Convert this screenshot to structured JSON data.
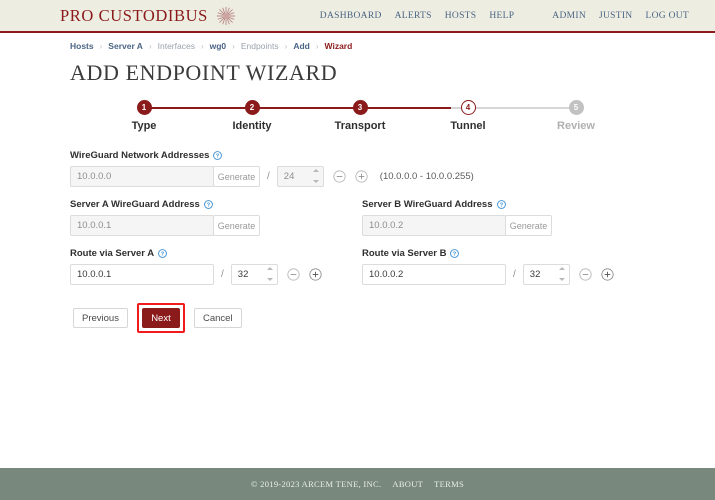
{
  "header": {
    "brand": "PRO CUSTODIBUS",
    "brand_emblem_icon": "sunburst-emblem-icon",
    "nav_primary": [
      {
        "label": "DASHBOARD"
      },
      {
        "label": "ALERTS"
      },
      {
        "label": "HOSTS"
      },
      {
        "label": "HELP"
      }
    ],
    "nav_account": [
      {
        "label": "ADMIN"
      },
      {
        "label": "JUSTIN"
      },
      {
        "label": "LOG OUT"
      }
    ]
  },
  "breadcrumb": {
    "separator": "›",
    "items": [
      {
        "label": "Hosts",
        "state": "link"
      },
      {
        "label": "Server A",
        "state": "link"
      },
      {
        "label": "Interfaces",
        "state": "muted"
      },
      {
        "label": "wg0",
        "state": "link"
      },
      {
        "label": "Endpoints",
        "state": "muted"
      },
      {
        "label": "Add",
        "state": "link"
      },
      {
        "label": "Wizard",
        "state": "current"
      }
    ]
  },
  "page": {
    "title": "ADD ENDPOINT WIZARD"
  },
  "stepper": {
    "steps": [
      {
        "number": "1",
        "label": "Type",
        "state": "done"
      },
      {
        "number": "2",
        "label": "Identity",
        "state": "done"
      },
      {
        "number": "3",
        "label": "Transport",
        "state": "done"
      },
      {
        "number": "4",
        "label": "Tunnel",
        "state": "current"
      },
      {
        "number": "5",
        "label": "Review",
        "state": "todo"
      }
    ]
  },
  "form": {
    "help_icon": "question-mark-circle-icon",
    "minus_icon": "minus-circle-icon",
    "plus_icon": "plus-circle-icon",
    "slash": "/",
    "network": {
      "label": "WireGuard Network Addresses",
      "address_value": "10.0.0.0",
      "address_placeholder": "10.0.0.0",
      "generate_label": "Generate",
      "prefix_value": "24",
      "range_text": "(10.0.0.0 - 10.0.0.255)"
    },
    "server_a_address": {
      "label": "Server A WireGuard Address",
      "value": "10.0.0.1",
      "generate_label": "Generate"
    },
    "server_b_address": {
      "label": "Server B WireGuard Address",
      "value": "10.0.0.2",
      "generate_label": "Generate"
    },
    "route_a": {
      "label": "Route via Server A",
      "value": "10.0.0.1",
      "prefix_value": "32"
    },
    "route_b": {
      "label": "Route via Server B",
      "value": "10.0.0.2",
      "prefix_value": "32"
    },
    "buttons": {
      "previous": "Previous",
      "next": "Next",
      "cancel": "Cancel"
    }
  },
  "footer": {
    "copyright": "© 2019-2023 ARCEM TENE, INC.",
    "links": [
      {
        "label": "ABOUT"
      },
      {
        "label": "TERMS"
      }
    ]
  },
  "colors": {
    "brand_red": "#8b1a1a",
    "header_bg": "#eeede2",
    "nav_blue": "#4a6484",
    "footer_bg": "#78887c",
    "highlight_red": "#f21b1b",
    "step_todo_grey": "#c2c2c2"
  }
}
